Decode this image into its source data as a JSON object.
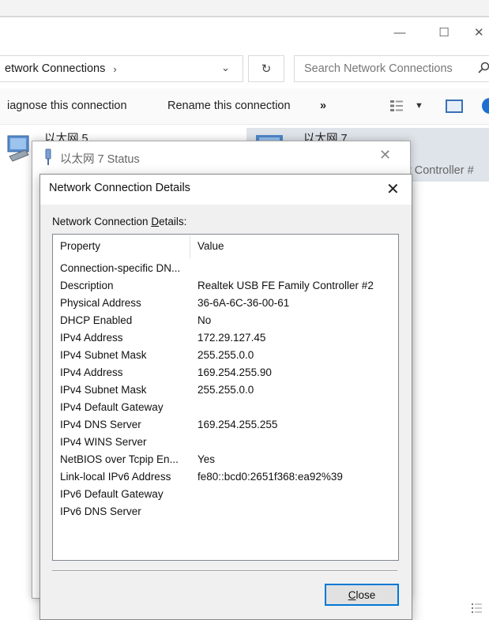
{
  "window": {
    "minimize_glyph": "—",
    "maximize_glyph": "☐",
    "close_glyph": "✕"
  },
  "address_bar": {
    "path": "etwork Connections",
    "chevron": "›",
    "dropdown": "⌄",
    "refresh_glyph": "↻"
  },
  "search": {
    "placeholder": "Search Network Connections"
  },
  "commandbar": {
    "diagnose": "iagnose this connection",
    "rename": "Rename this connection",
    "more": "»",
    "view_dropdown": "▼"
  },
  "items": [
    {
      "name": "以太网 5",
      "description": ""
    },
    {
      "name": "以太网 7",
      "description": "ily Controller #"
    }
  ],
  "status_window": {
    "title": "以太网 7 Status",
    "close": "✕"
  },
  "details_dialog": {
    "title": "Network Connection Details",
    "close": "✕",
    "group_label_prefix": "Network Connection ",
    "group_label_access": "D",
    "group_label_suffix": "etails:",
    "columns": {
      "property": "Property",
      "value": "Value"
    },
    "rows": [
      {
        "property": "Connection-specific DN...",
        "value": ""
      },
      {
        "property": "Description",
        "value": "Realtek USB FE Family Controller #2"
      },
      {
        "property": "Physical Address",
        "value": "36-6A-6C-36-00-61"
      },
      {
        "property": "DHCP Enabled",
        "value": "No"
      },
      {
        "property": "IPv4 Address",
        "value": "172.29.127.45"
      },
      {
        "property": "IPv4 Subnet Mask",
        "value": "255.255.0.0"
      },
      {
        "property": "IPv4 Address",
        "value": "169.254.255.90"
      },
      {
        "property": "IPv4 Subnet Mask",
        "value": "255.255.0.0"
      },
      {
        "property": "IPv4 Default Gateway",
        "value": ""
      },
      {
        "property": "IPv4 DNS Server",
        "value": "169.254.255.255"
      },
      {
        "property": "IPv4 WINS Server",
        "value": ""
      },
      {
        "property": "NetBIOS over Tcpip En...",
        "value": "Yes"
      },
      {
        "property": "Link-local IPv6 Address",
        "value": "fe80::bcd0:2651f368:ea92%39"
      },
      {
        "property": "IPv6 Default Gateway",
        "value": ""
      },
      {
        "property": "IPv6 DNS Server",
        "value": ""
      }
    ],
    "close_button_access": "C",
    "close_button_rest": "lose"
  }
}
